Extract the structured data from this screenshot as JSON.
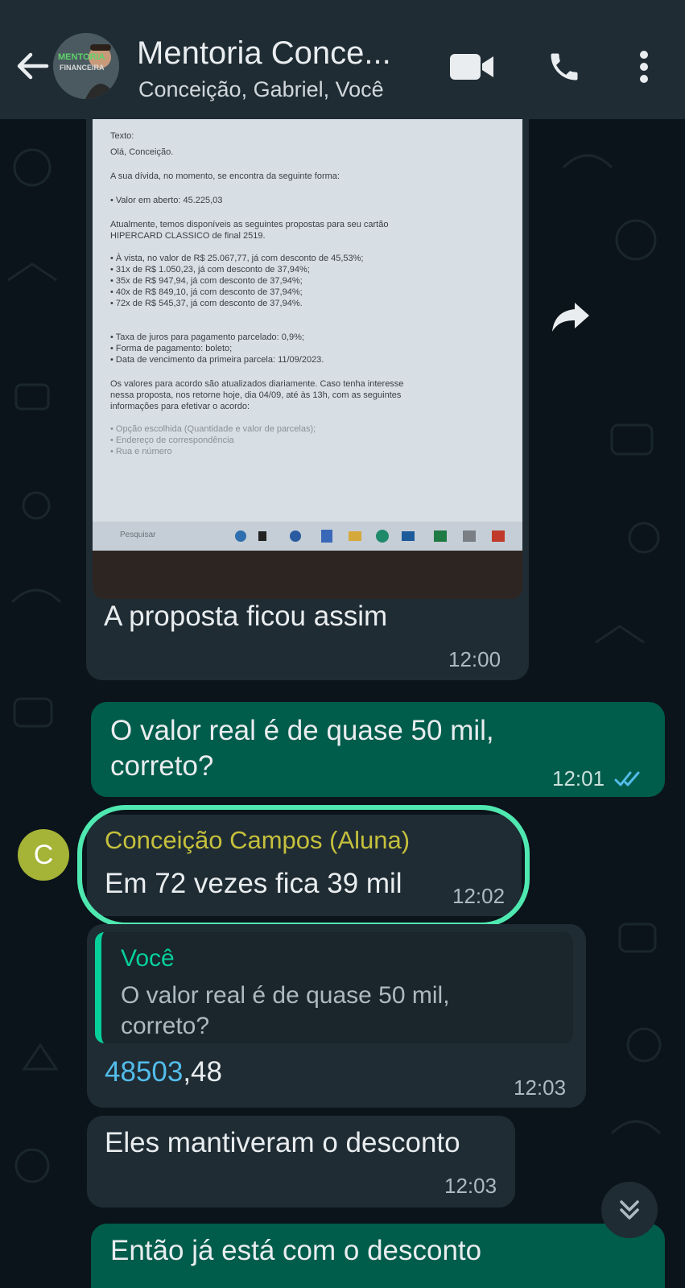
{
  "header": {
    "title": "Mentoria Conce...",
    "subtitle": "Conceição, Gabriel, Você",
    "avatar_text_1": "MENTORIA",
    "avatar_text_2": "FINANCEIRA"
  },
  "photo": {
    "lines": [
      "Texto:",
      "Olá, Conceição.",
      "A sua dívida, no momento, se encontra da seguinte forma:",
      "• Valor em aberto: 45.225,03",
      "Atualmente, temos disponíveis as seguintes propostas para seu cartão",
      "HIPERCARD CLASSICO de final 2519.",
      "• À vista, no valor de R$ 25.067,77, já com desconto de 45,53%;",
      "• 31x de R$ 1.050,23, já com desconto de 37,94%;",
      "• 35x de R$ 947,94, já com desconto de 37,94%;",
      "• 40x de R$ 849,10, já com desconto de 37,94%;",
      "• 72x de R$ 545,37, já com desconto de 37,94%.",
      "• Taxa de juros para pagamento parcelado: 0,9%;",
      "• Forma de pagamento: boleto;",
      "• Data de vencimento da primeira parcela: 11/09/2023.",
      "Os valores para acordo são atualizados diariamente. Caso tenha interesse",
      "nessa proposta, nos retorne hoje, dia 04/09, até às 13h, com as seguintes",
      "informações para efetivar o acordo:",
      "• Opção escolhida (Quantidade e valor de parcelas);",
      "• Endereço de correspondência",
      "• Rua e número"
    ],
    "taskbar_search": "Pesquisar"
  },
  "messages": {
    "m1": {
      "text": "A proposta ficou assim",
      "time": "12:00"
    },
    "m2": {
      "text_line1": "O valor real é de quase 50 mil,",
      "text_line2": "correto?",
      "time": "12:01"
    },
    "m3": {
      "sender": "Conceição Campos (Aluna)",
      "text": "Em 72 vezes fica 39 mil",
      "time": "12:02",
      "avatar_letter": "C"
    },
    "m4": {
      "quote_sender": "Você",
      "quote_line1": "O valor real é de quase 50 mil,",
      "quote_line2": "correto?",
      "text_link": "48503",
      "text_rest": ",48",
      "time": "12:03"
    },
    "m5": {
      "text": "Eles mantiveram o desconto",
      "time": "12:03"
    },
    "m6": {
      "text_partial": "Então já está com o desconto"
    }
  },
  "colors": {
    "header_bg": "#1f2c34",
    "chat_bg": "#0b141a",
    "incoming_bubble": "#1f2c34",
    "outgoing_bubble": "#005c4b",
    "sender_name": "#c5c03c",
    "quote_accent": "#06cf9c",
    "link": "#53bdeb",
    "read_ticks": "#53bdeb",
    "highlight_stroke": "#4fe8b0"
  },
  "icons": [
    "back-arrow-icon",
    "video-call-icon",
    "phone-icon",
    "more-options-icon",
    "forward-icon",
    "double-check-icon",
    "scroll-down-icon"
  ]
}
